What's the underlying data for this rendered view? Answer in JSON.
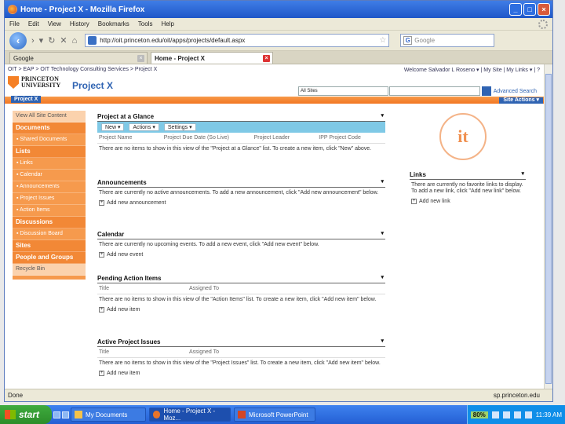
{
  "window": {
    "title": "Home - Project X - Mozilla Firefox"
  },
  "menus": [
    "File",
    "Edit",
    "View",
    "History",
    "Bookmarks",
    "Tools",
    "Help"
  ],
  "nav": {
    "url": "http://oit.princeton.edu/oit/apps/projects/default.aspx",
    "search_placeholder": "Google"
  },
  "tabs": [
    {
      "label": "Google",
      "active": false
    },
    {
      "label": "Home - Project X",
      "active": true
    }
  ],
  "site": {
    "breadcrumb": "OIT > EAP > OIT Technology Consulting Services > Project X",
    "welcome": "Welcome Salvador L Roseno ▾ | My Site | My Links ▾ | ?",
    "logo": [
      "PRINCETON",
      "UNIVERSITY"
    ],
    "title": "Project X",
    "tab": "Project X",
    "search_scope": "All Sites",
    "advanced_search": "Advanced Search",
    "site_actions": "Site Actions ▾"
  },
  "leftnav": [
    {
      "type": "link",
      "label": "View All Site Content"
    },
    {
      "type": "head",
      "label": "Documents"
    },
    {
      "type": "item",
      "label": "▪ Shared Documents"
    },
    {
      "type": "head",
      "label": "Lists"
    },
    {
      "type": "item",
      "label": "▪ Links"
    },
    {
      "type": "item",
      "label": "▪ Calendar"
    },
    {
      "type": "item",
      "label": "▪ Announcements"
    },
    {
      "type": "item",
      "label": "▪ Project Issues"
    },
    {
      "type": "item",
      "label": "▪ Action Items"
    },
    {
      "type": "head",
      "label": "Discussions"
    },
    {
      "type": "item",
      "label": "▪ Discussion Board"
    },
    {
      "type": "head",
      "label": "Sites"
    },
    {
      "type": "head",
      "label": "People and Groups"
    },
    {
      "type": "link",
      "label": "Recycle Bin"
    }
  ],
  "glance": {
    "title": "Project at a Glance",
    "toolbar": [
      "New ▾",
      "Actions ▾",
      "Settings ▾"
    ],
    "columns": [
      "Project Name",
      "Project Due Date (So Live)",
      "Project Leader",
      "IPP Project Code"
    ],
    "empty": "There are no items to show in this view of the \"Project at a Glance\" list. To create a new item, click \"New\" above."
  },
  "announcements": {
    "title": "Announcements",
    "empty": "There are currently no active announcements. To add a new announcement, click \"Add new announcement\" below.",
    "add": "Add new announcement"
  },
  "calendar": {
    "title": "Calendar",
    "empty": "There are currently no upcoming events. To add a new event, click \"Add new event\" below.",
    "add": "Add new event"
  },
  "pending": {
    "title": "Pending Action Items",
    "columns": [
      "Title",
      "Assigned To"
    ],
    "empty": "There are no items to show in this view of the \"Action Items\" list. To create a new item, click \"Add new item\" below.",
    "add": "Add new item"
  },
  "issues": {
    "title": "Active Project Issues",
    "columns": [
      "Title",
      "Assigned To"
    ],
    "empty": "There are no items to show in this view of the \"Project Issues\" list. To create a new item, click \"Add new item\" below.",
    "add": "Add new item"
  },
  "links": {
    "logo_text": "it",
    "title": "Links",
    "empty": "There are currently no favorite links to display. To add a new link, click \"Add new link\" below.",
    "add": "Add new link"
  },
  "status": {
    "left": "Done",
    "right": "sp.princeton.edu"
  },
  "taskbar": {
    "start": "start",
    "tasks": [
      {
        "label": "My Documents",
        "active": false
      },
      {
        "label": "Home - Project X - Moz...",
        "active": true
      },
      {
        "label": "Microsoft PowerPoint",
        "active": false
      }
    ],
    "battery": "80%",
    "clock": "11:39 AM"
  }
}
